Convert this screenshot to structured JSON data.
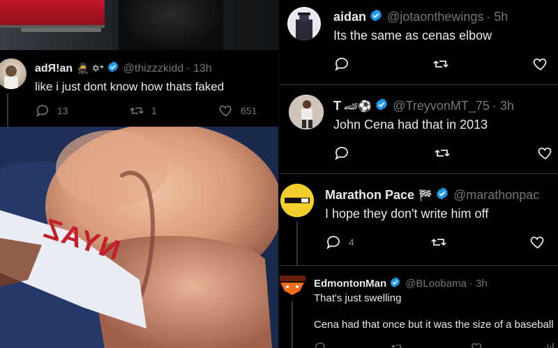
{
  "tweets": {
    "adrian": {
      "name": "adЯ!an",
      "emoji": "🥷 ✡*",
      "handle": "@thizzzkidd",
      "time": "· 13h",
      "text": "like i just dont know how thats faked",
      "replies": "13",
      "retweets": "1",
      "likes": "651"
    },
    "aidan": {
      "name": "aidan",
      "handle": "@jotaonthewings",
      "time": "· 5h",
      "text": "Its the same as cenas elbow"
    },
    "t": {
      "name": "T",
      "emoji": "🏎⚽",
      "handle": "@TreyvonMT_75",
      "time": "· 3h",
      "text": "John Cena had that in 2013"
    },
    "marathon": {
      "name": "Marathon Pace",
      "emoji": "🏁",
      "handle": "@marathonpac",
      "text": "I hope they don't write him off",
      "replies": "4"
    },
    "edmonton": {
      "name": "EdmontonMan",
      "handle": "@BLoobama",
      "time": "· 3h",
      "text_line1": "That's just swelling",
      "text_line2": "Cena had that once but it was the size of a baseball"
    }
  },
  "photo": {
    "shirt_text": "NYAZ"
  },
  "colors": {
    "background": "#000000",
    "text": "#e7e9ea",
    "muted": "#71767b",
    "verified": "#1d9bf0",
    "divider": "#2f3336"
  }
}
